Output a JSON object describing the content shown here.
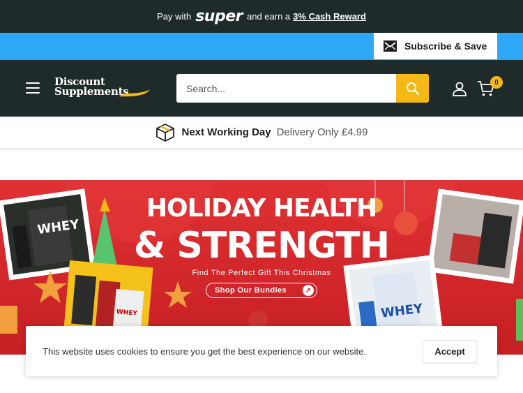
{
  "promo": {
    "prefix": "Pay with",
    "brand": "super",
    "middle": "and earn a",
    "reward": "3% Cash Reward"
  },
  "subscribe": {
    "label": "Subscribe & Save",
    "icon": "mail-icon"
  },
  "header": {
    "logo_line1": "Discount",
    "logo_line2": "Supplements",
    "search_placeholder": "Search...",
    "cart_count": "0"
  },
  "delivery": {
    "strong": "Next Working Day",
    "light": "Delivery Only £4.99",
    "icon": "box-icon"
  },
  "banner": {
    "title1": "HOLIDAY HEALTH",
    "title2": "& STRENGTH",
    "subtitle": "Find The Perfect Gift This Christmas",
    "button": "Shop Our Bundles"
  },
  "cookie": {
    "message": "This website uses cookies to ensure you get the best experience on our website.",
    "accept": "Accept"
  },
  "colors": {
    "dark": "#1f2a2a",
    "blue": "#2ea8f4",
    "yellow": "#f5b915",
    "red": "#d8262a"
  }
}
